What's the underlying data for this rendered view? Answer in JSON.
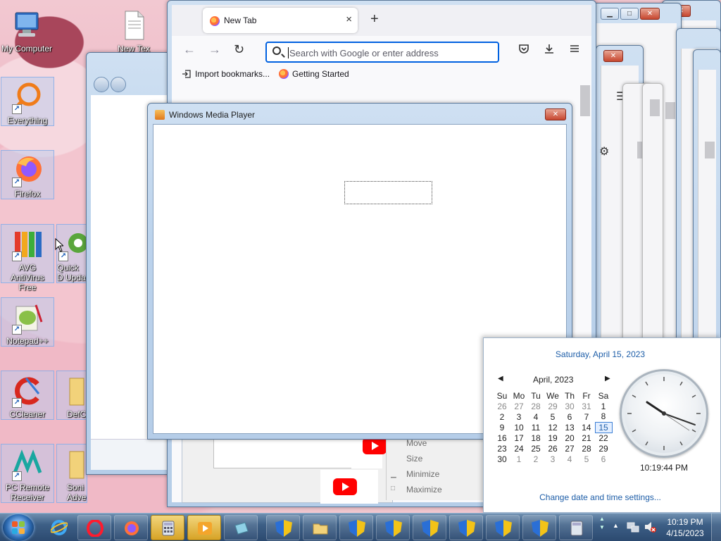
{
  "desktop": {
    "icons": [
      {
        "label": "My Computer"
      },
      {
        "label": "New Tex"
      },
      {
        "label": "Everything"
      },
      {
        "label": "Firefox"
      },
      {
        "label": "AVG AntiVirus Free"
      },
      {
        "label": "Quick D Upda"
      },
      {
        "label": "Notepad++"
      },
      {
        "label": "CCleaner"
      },
      {
        "label": "DefC"
      },
      {
        "label": "PC Remote Receiver"
      },
      {
        "label": "Soni Adventu"
      }
    ]
  },
  "firefox": {
    "tab_title": "New Tab",
    "tab_close": "×",
    "new_tab": "+",
    "url_placeholder": "Search with Google or enter address",
    "bookmarks": [
      {
        "label": "Import bookmarks..."
      },
      {
        "label": "Getting Started"
      }
    ],
    "window_buttons": {
      "minimize": "▁",
      "maximize": "□",
      "close": "✕"
    }
  },
  "wmp": {
    "title": "Windows Media Player",
    "close": "✕"
  },
  "context_menu": {
    "items": [
      "Move",
      "Size",
      "Minimize",
      "Maximize"
    ]
  },
  "clock_flyout": {
    "full_date": "Saturday, April 15, 2023",
    "month_label": "April, 2023",
    "prev": "◀",
    "next": "▶",
    "weekdays": [
      "Su",
      "Mo",
      "Tu",
      "We",
      "Th",
      "Fr",
      "Sa"
    ],
    "weeks": [
      [
        {
          "d": "26",
          "dim": true
        },
        {
          "d": "27",
          "dim": true
        },
        {
          "d": "28",
          "dim": true
        },
        {
          "d": "29",
          "dim": true
        },
        {
          "d": "30",
          "dim": true
        },
        {
          "d": "31",
          "dim": true
        },
        {
          "d": "1"
        }
      ],
      [
        {
          "d": "2"
        },
        {
          "d": "3"
        },
        {
          "d": "4"
        },
        {
          "d": "5"
        },
        {
          "d": "6"
        },
        {
          "d": "7"
        },
        {
          "d": "8"
        }
      ],
      [
        {
          "d": "9"
        },
        {
          "d": "10"
        },
        {
          "d": "11"
        },
        {
          "d": "12"
        },
        {
          "d": "13"
        },
        {
          "d": "14"
        },
        {
          "d": "15",
          "today": true
        }
      ],
      [
        {
          "d": "16"
        },
        {
          "d": "17"
        },
        {
          "d": "18"
        },
        {
          "d": "19"
        },
        {
          "d": "20"
        },
        {
          "d": "21"
        },
        {
          "d": "22"
        }
      ],
      [
        {
          "d": "23"
        },
        {
          "d": "24"
        },
        {
          "d": "25"
        },
        {
          "d": "26"
        },
        {
          "d": "27"
        },
        {
          "d": "28"
        },
        {
          "d": "29"
        }
      ],
      [
        {
          "d": "30"
        },
        {
          "d": "1",
          "dim": true
        },
        {
          "d": "2",
          "dim": true
        },
        {
          "d": "3",
          "dim": true
        },
        {
          "d": "4",
          "dim": true
        },
        {
          "d": "5",
          "dim": true
        },
        {
          "d": "6",
          "dim": true
        }
      ]
    ],
    "time": "10:19:44 PM",
    "settings_link": "Change date and time settings..."
  },
  "taskbar": {
    "time": "10:19 PM",
    "date": "4/15/2023"
  },
  "colors": {
    "link_blue": "#1e5ea8",
    "firefox_focus": "#0061e0",
    "taskbar": "#2c4a70"
  }
}
